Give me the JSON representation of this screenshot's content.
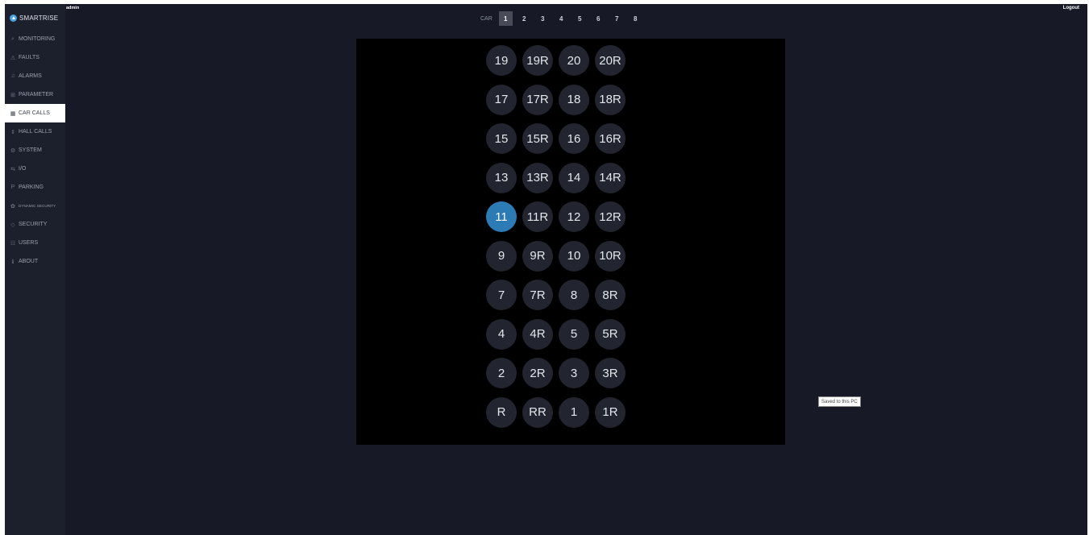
{
  "top_bar": {
    "user": "admin",
    "logout_label": "Logout"
  },
  "sidebar": {
    "brand": "SMARTRISE",
    "items": [
      {
        "label": "MONITORING",
        "icon": "search-icon",
        "glyph": "⌕"
      },
      {
        "label": "FAULTS",
        "icon": "warning-icon",
        "glyph": "⚠"
      },
      {
        "label": "ALARMS",
        "icon": "bell-icon",
        "glyph": "♫"
      },
      {
        "label": "PARAMETER",
        "icon": "parameter-icon",
        "glyph": "⊞"
      },
      {
        "label": "CAR CALLS",
        "icon": "car-calls-icon",
        "glyph": "▦",
        "active": true
      },
      {
        "label": "HALL CALLS",
        "icon": "hall-calls-icon",
        "glyph": "⇕"
      },
      {
        "label": "SYSTEM",
        "icon": "system-icon",
        "glyph": "⚙"
      },
      {
        "label": "I/O",
        "icon": "io-icon",
        "glyph": "⇆"
      },
      {
        "label": "PARKING",
        "icon": "parking-icon",
        "glyph": "P"
      },
      {
        "label": "DYNAMIC SECURITY",
        "icon": "dynamic-security-icon",
        "glyph": "✿",
        "small": true
      },
      {
        "label": "SECURITY",
        "icon": "shield-icon",
        "glyph": "◇"
      },
      {
        "label": "USERS",
        "icon": "users-icon",
        "glyph": "☷"
      },
      {
        "label": "ABOUT",
        "icon": "info-icon",
        "glyph": "ℹ"
      }
    ]
  },
  "car_selector": {
    "label": "CAR",
    "cars": [
      "1",
      "2",
      "3",
      "4",
      "5",
      "6",
      "7",
      "8"
    ],
    "selected": "1"
  },
  "floor_panel": {
    "rows": [
      [
        "19",
        "19R",
        "20",
        "20R"
      ],
      [
        "17",
        "17R",
        "18",
        "18R"
      ],
      [
        "15",
        "15R",
        "16",
        "16R"
      ],
      [
        "13",
        "13R",
        "14",
        "14R"
      ],
      [
        "11",
        "11R",
        "12",
        "12R"
      ],
      [
        "9",
        "9R",
        "10",
        "10R"
      ],
      [
        "7",
        "7R",
        "8",
        "8R"
      ],
      [
        "4",
        "4R",
        "5",
        "5R"
      ],
      [
        "2",
        "2R",
        "3",
        "3R"
      ],
      [
        "R",
        "RR",
        "1",
        "1R"
      ]
    ],
    "active_floor": "11"
  },
  "tooltip": "Saved to this PC",
  "colors": {
    "background": "#171a26",
    "sidebar": "#1c1f2c",
    "panel": "#000000",
    "button": "#22252f",
    "active_button": "#2d7bb5"
  }
}
